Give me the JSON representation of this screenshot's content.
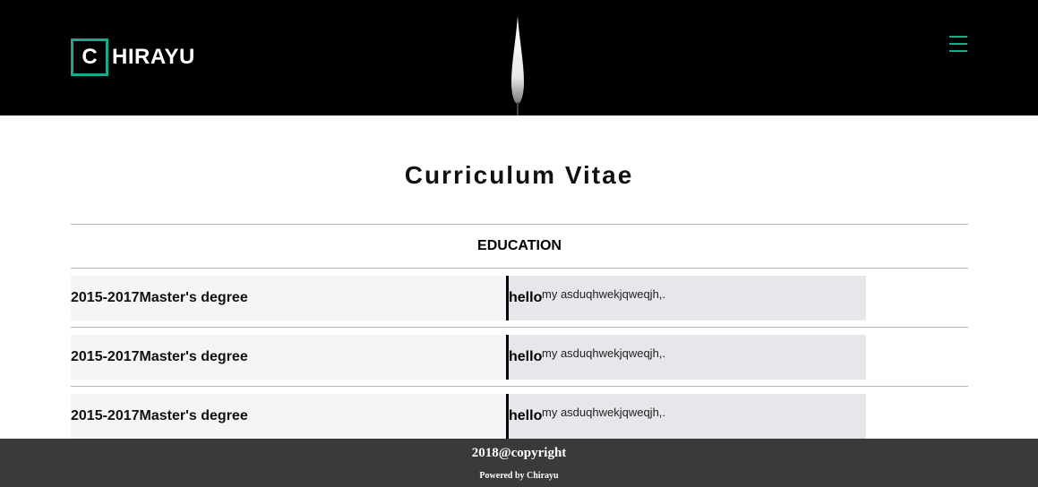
{
  "header": {
    "logo_letter": "C",
    "logo_text": "HIRAYU",
    "accent_color": "#1aa88c",
    "menu_icon": "hamburger-icon",
    "hero_image": "candle-flame"
  },
  "main": {
    "title": "Curriculum Vitae",
    "section_title": "EDUCATION",
    "rows": [
      {
        "period": "2015-2017",
        "degree": "Master's degree",
        "heading": "hello",
        "description": "my asduqhwekjqweqjh,."
      },
      {
        "period": "2015-2017",
        "degree": "Master's degree",
        "heading": "hello",
        "description": "my asduqhwekjqweqjh,."
      },
      {
        "period": "2015-2017",
        "degree": "Master's degree",
        "heading": "hello",
        "description": "my asduqhwekjqweqjh,."
      }
    ]
  },
  "footer": {
    "copyright": "2018@copyright",
    "powered_by": "Powered by Chirayu"
  }
}
